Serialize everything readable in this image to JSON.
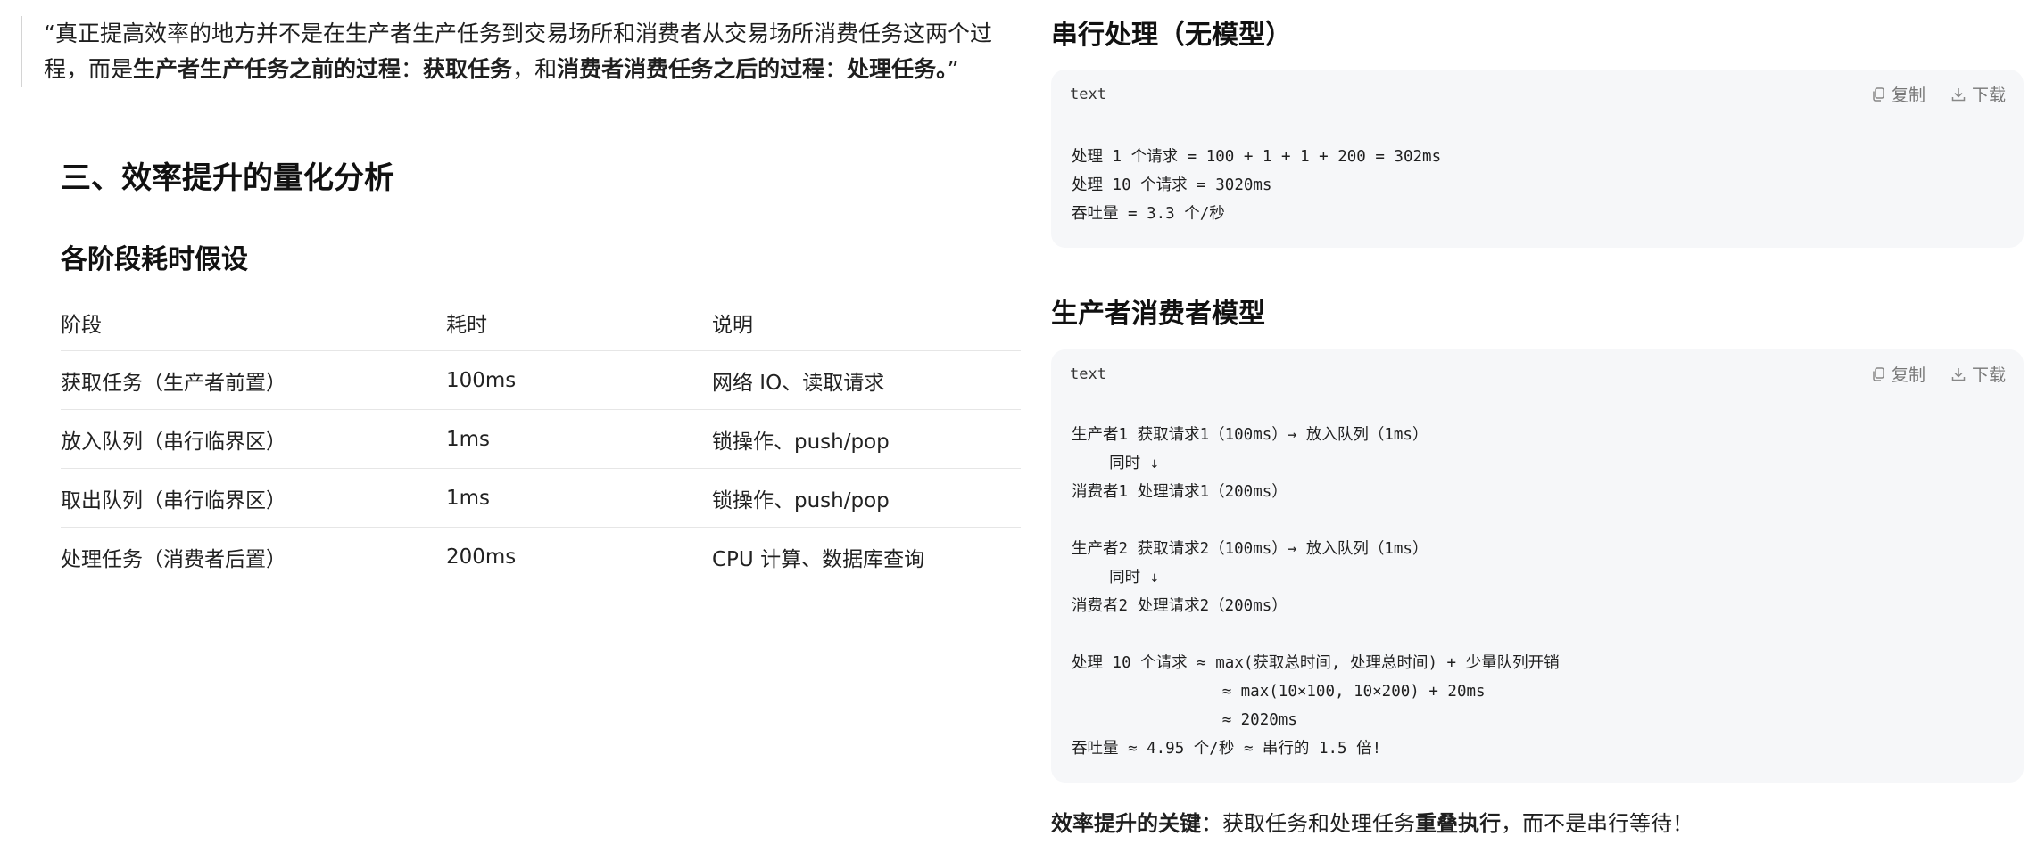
{
  "quote": {
    "open": "“真正提高效率的地方并不是在生产者生产任务到交易场所和消费者从交易场所消费任务这两个过程，而是",
    "b1": "生产者生产任务之前的过程",
    "sep1": "：",
    "b2": "获取任务",
    "mid": "，和",
    "b3": "消费者消费任务之后的过程",
    "sep2": "：",
    "b4": "处理任务。",
    "close": "”"
  },
  "section_title": "三、效率提升的量化分析",
  "subsection_title": "各阶段耗时假设",
  "table": {
    "headers": [
      "阶段",
      "耗时",
      "说明"
    ],
    "rows": [
      [
        "获取任务（生产者前置）",
        "100ms",
        "网络 IO、读取请求"
      ],
      [
        "放入队列（串行临界区）",
        "1ms",
        "锁操作、push/pop"
      ],
      [
        "取出队列（串行临界区）",
        "1ms",
        "锁操作、push/pop"
      ],
      [
        "处理任务（消费者后置）",
        "200ms",
        "CPU 计算、数据库查询"
      ]
    ]
  },
  "serial": {
    "title": "串行处理（无模型）",
    "lang": "text",
    "copy_label": "复制",
    "download_label": "下载",
    "code": "处理 1 个请求 = 100 + 1 + 1 + 200 = 302ms\n处理 10 个请求 = 3020ms\n吞吐量 = 3.3 个/秒"
  },
  "pc": {
    "title": "生产者消费者模型",
    "lang": "text",
    "copy_label": "复制",
    "download_label": "下载",
    "code": "生产者1 获取请求1（100ms）→ 放入队列（1ms）\n    同时 ↓\n消费者1 处理请求1（200ms）\n\n生产者2 获取请求2（100ms）→ 放入队列（1ms）\n    同时 ↓\n消费者2 处理请求2（200ms）\n\n处理 10 个请求 ≈ max(获取总时间, 处理总时间) + 少量队列开销\n                ≈ max(10×100, 10×200) + 20ms\n                ≈ 2020ms\n吞吐量 ≈ 4.95 个/秒 ≈ 串行的 1.5 倍!"
  },
  "footer": {
    "b1": "效率提升的关键",
    "mid": "：获取任务和处理任务",
    "b2": "重叠执行",
    "end": "，而不是串行等待！"
  }
}
